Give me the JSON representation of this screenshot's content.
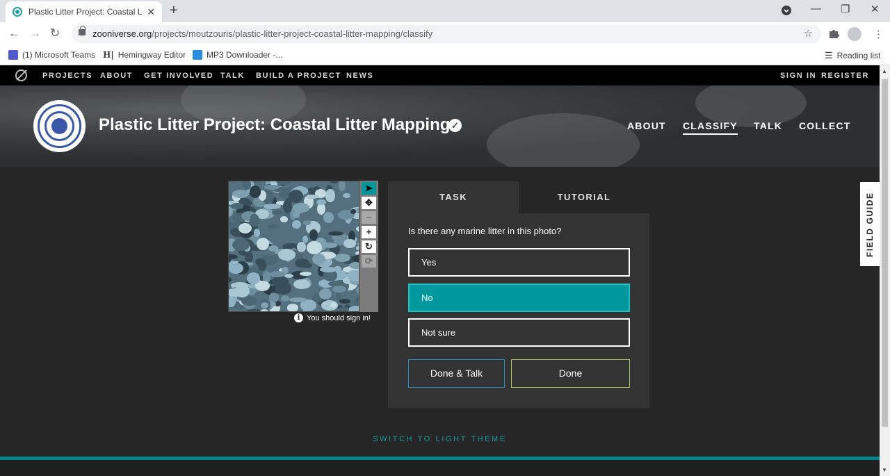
{
  "browser": {
    "tab_title": "Plastic Litter Project: Coastal Litte",
    "new_tab": "+",
    "url_domain": "zooniverse.org",
    "url_path": "/projects/moutzouris/plastic-litter-project-coastal-litter-mapping/classify",
    "bookmarks": [
      "(1) Microsoft Teams",
      "Hemingway Editor",
      "MP3 Downloader -..."
    ],
    "reading_list": "Reading list"
  },
  "zoo_nav": {
    "links": [
      "PROJECTS",
      "ABOUT",
      "GET INVOLVED",
      "TALK",
      "BUILD A PROJECT",
      "NEWS"
    ],
    "sign_in": "SIGN IN",
    "register": "REGISTER"
  },
  "project": {
    "title": "Plastic Litter Project: Coastal Litter Mapping",
    "nav": [
      "ABOUT",
      "CLASSIFY",
      "TALK",
      "COLLECT"
    ],
    "active_nav": "CLASSIFY"
  },
  "viewer": {
    "tools": [
      "pointer-icon",
      "move-icon",
      "zoom-out-icon",
      "zoom-in-icon",
      "rotate-icon",
      "reset-icon"
    ],
    "signin_note": "You should sign in!"
  },
  "task": {
    "tabs": [
      "TASK",
      "TUTORIAL"
    ],
    "question": "Is there any marine litter in this photo?",
    "answers": [
      "Yes",
      "No",
      "Not sure"
    ],
    "selected_answer": "No",
    "done_talk": "Done & Talk",
    "done": "Done"
  },
  "field_guide": "FIELD GUIDE",
  "switch_theme": "SWITCH TO LIGHT THEME",
  "colors": {
    "accent": "#00979d",
    "done_talk_border": "#1a8fc8",
    "done_border": "#a6c95d"
  }
}
